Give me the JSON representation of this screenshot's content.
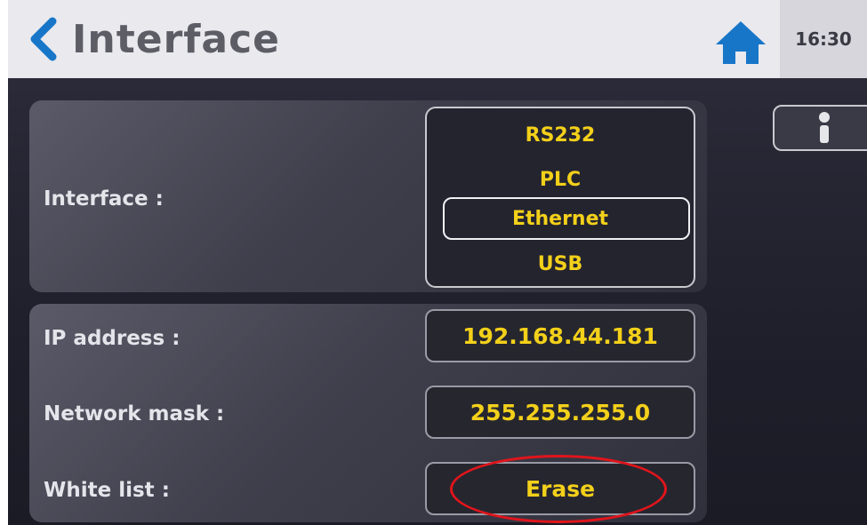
{
  "header": {
    "title": "Interface",
    "time": "16:30",
    "back_icon": "chevron-left-icon",
    "home_icon": "home-icon"
  },
  "interface_panel": {
    "label": "Interface :",
    "options": [
      "RS232",
      "PLC",
      "Ethernet",
      "USB"
    ],
    "selected": "Ethernet"
  },
  "network_panel": {
    "ip_label": "IP address :",
    "ip_value": "192.168.44.181",
    "mask_label": "Network mask :",
    "mask_value": "255.255.255.0",
    "whitelist_label": "White list :",
    "erase_label": "Erase"
  },
  "side": {
    "info_icon": "info-icon"
  },
  "colors": {
    "accent_yellow": "#f3d01a",
    "header_blue": "#1876c8",
    "highlight_red": "#e0151b"
  }
}
